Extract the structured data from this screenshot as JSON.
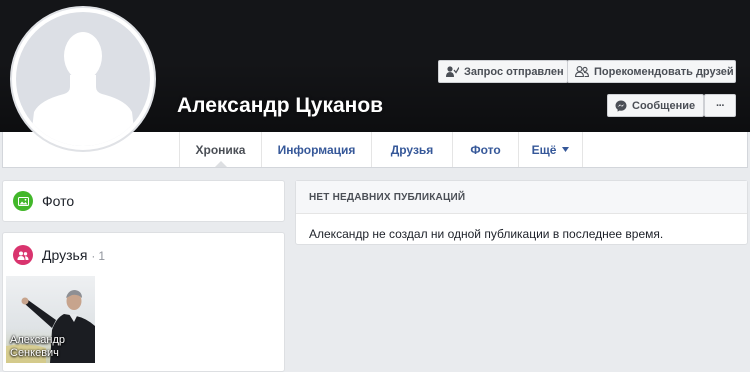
{
  "profile": {
    "name": "Александр Цуканов"
  },
  "actions": {
    "request_sent": "Запрос отправлен",
    "recommend_friends": "Порекомендовать друзей",
    "message": "Сообщение",
    "more": "···"
  },
  "tabs": [
    {
      "label": "Хроника",
      "active": true
    },
    {
      "label": "Информация",
      "active": false
    },
    {
      "label": "Друзья",
      "active": false
    },
    {
      "label": "Фото",
      "active": false
    },
    {
      "label": "Ещё",
      "active": false
    }
  ],
  "sidebar": {
    "photos_title": "Фото",
    "friends_title": "Друзья",
    "friends_separator": "·",
    "friends_count": "1",
    "friend": {
      "first_name": "Александр",
      "last_name": "Сенкевич"
    }
  },
  "feed": {
    "header": "НЕТ НЕДАВНИХ ПУБЛИКАЦИЙ",
    "empty_text": "Александр не создал ни одной публикации в последнее время."
  },
  "colors": {
    "cover": "#141518",
    "link_blue": "#365899",
    "photos_icon": "#42b72a",
    "friends_icon": "#d9346e"
  },
  "icons": {
    "request": "person-check-icon",
    "recommend": "people-outline-icon",
    "message": "messenger-icon",
    "dropdown": "caret-down-icon",
    "photos": "photos-icon",
    "friends": "friends-icon"
  }
}
